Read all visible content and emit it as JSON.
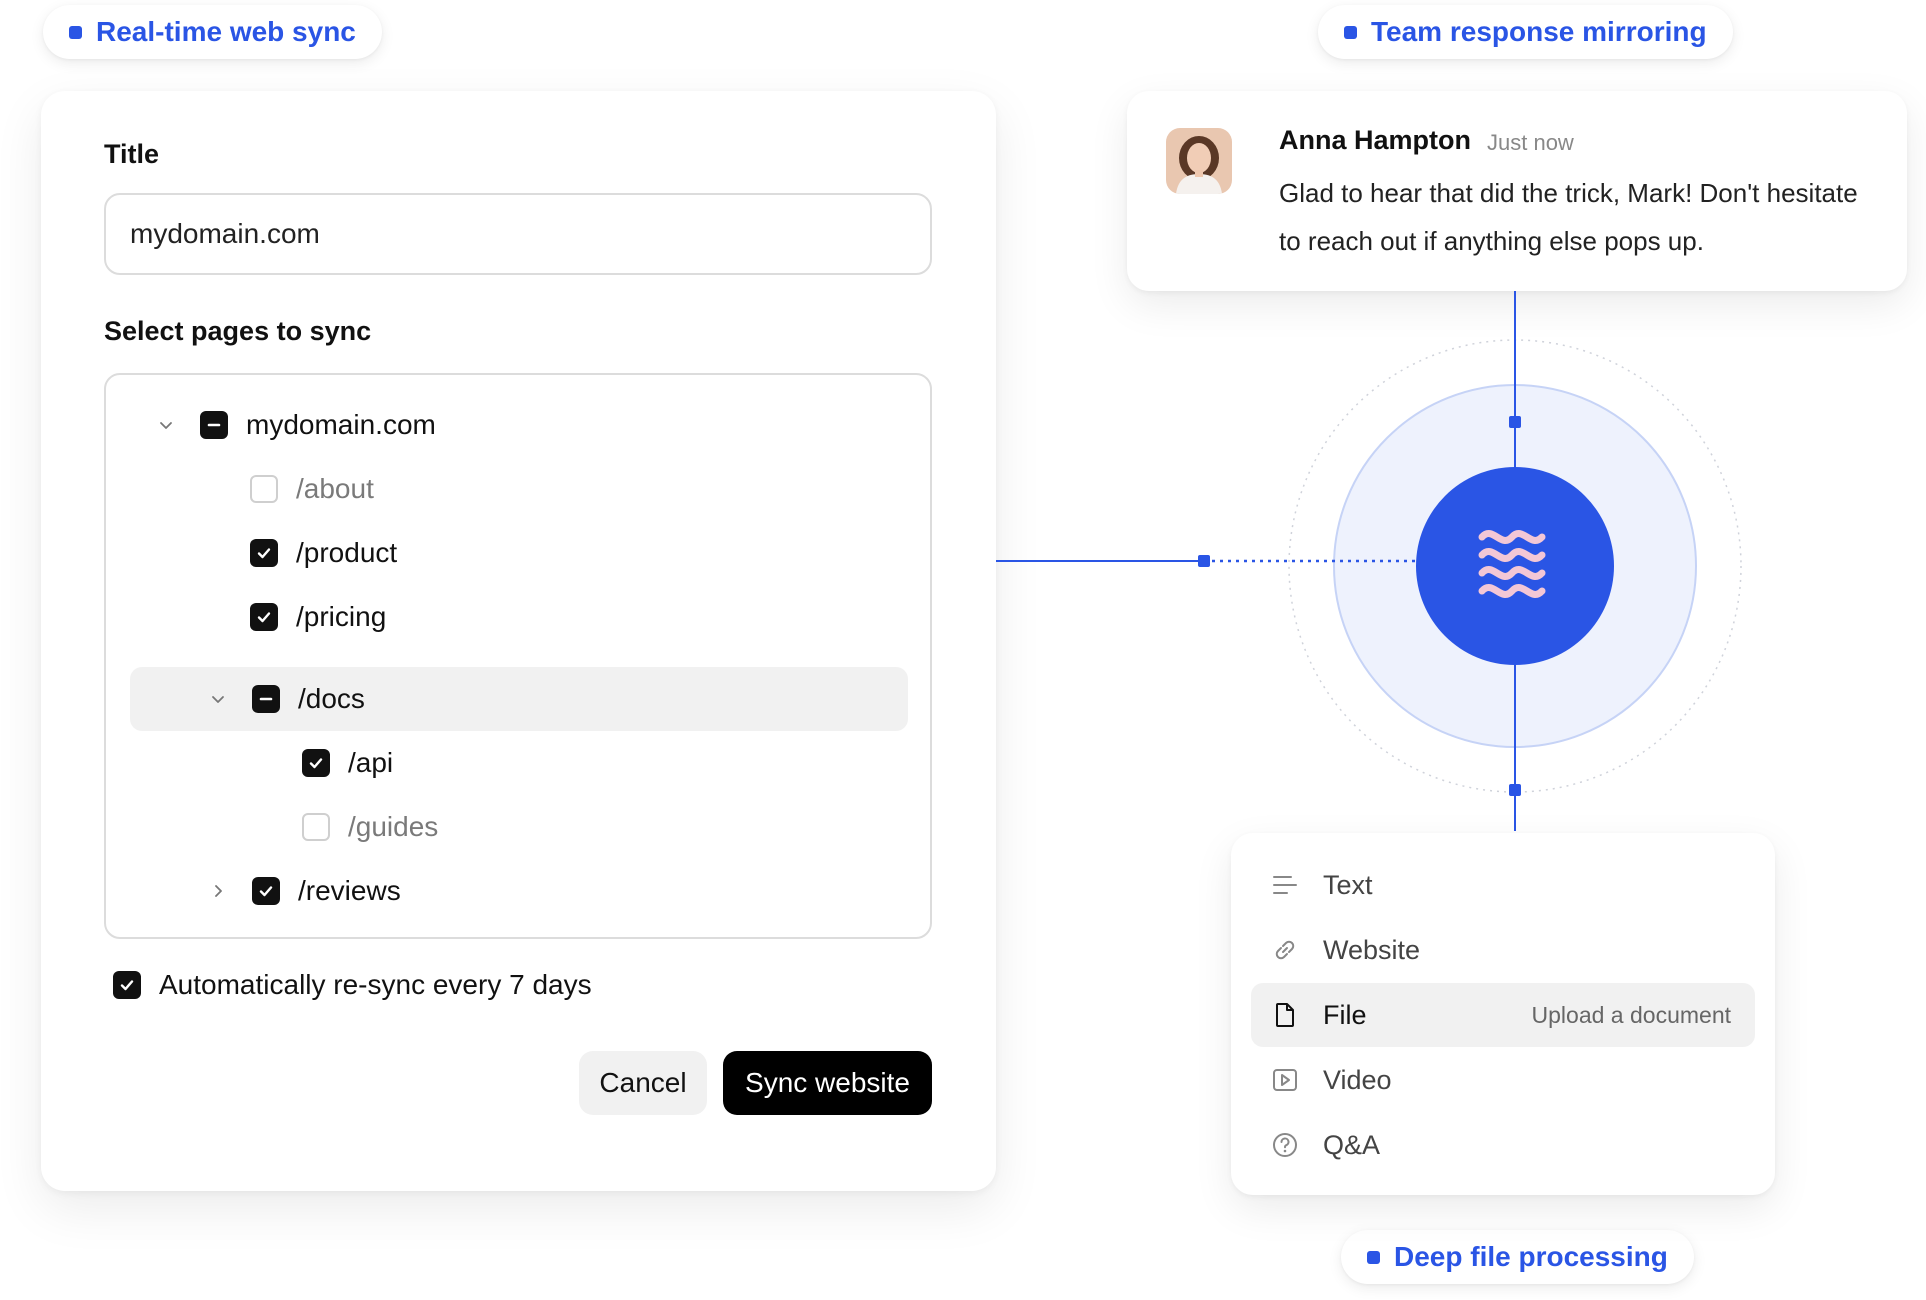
{
  "badges": {
    "web_sync": "Real-time web sync",
    "team_mirroring": "Team response mirroring",
    "deep_file": "Deep file processing"
  },
  "form": {
    "title_label": "Title",
    "title_value": "mydomain.com",
    "pages_label": "Select pages to sync",
    "tree": {
      "root": "mydomain.com",
      "about": "/about",
      "product": "/product",
      "pricing": "/pricing",
      "docs": "/docs",
      "api": "/api",
      "guides": "/guides",
      "reviews": "/reviews"
    },
    "auto_resync": "Automatically re-sync every 7 days",
    "cancel": "Cancel",
    "sync": "Sync website"
  },
  "chat": {
    "name": "Anna Hampton",
    "time": "Just now",
    "message": "Glad to hear that did the trick, Mark! Don't hesitate to reach out if anything else pops up."
  },
  "sources": {
    "items": [
      {
        "label": "Text",
        "icon": "text-lines-icon"
      },
      {
        "label": "Website",
        "icon": "link-icon"
      },
      {
        "label": "File",
        "icon": "file-icon",
        "hint": "Upload a document"
      },
      {
        "label": "Video",
        "icon": "video-play-icon"
      },
      {
        "label": "Q&A",
        "icon": "question-circle-icon"
      }
    ]
  },
  "colors": {
    "accent": "#2a55e5",
    "halo": "#eef2fd",
    "logo": "#f3c7d6"
  }
}
